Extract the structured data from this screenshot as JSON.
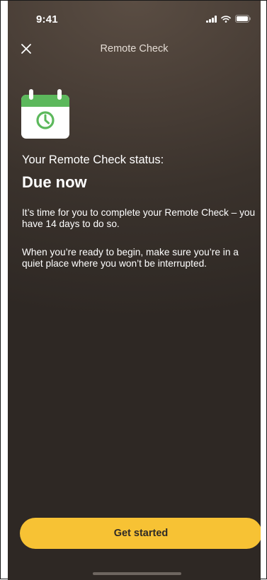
{
  "status_bar": {
    "time": "9:41"
  },
  "nav": {
    "title": "Remote Check"
  },
  "content": {
    "status_label": "Your Remote Check status:",
    "status_value": "Due now",
    "paragraph_1": "It’s time for you to complete your Remote Check – you have 14 days to do so.",
    "paragraph_2": "When you’re ready to begin, make sure you’re in a quiet place where you won’t be interrupted."
  },
  "actions": {
    "get_started_label": "Get started"
  },
  "colors": {
    "accent": "#f7c234",
    "calendar_green": "#5cb85c",
    "background": "#3a322c"
  },
  "icons": {
    "close": "close-icon",
    "calendar": "calendar-clock-icon",
    "signal": "cellular-signal-icon",
    "wifi": "wifi-icon",
    "battery": "battery-icon"
  }
}
